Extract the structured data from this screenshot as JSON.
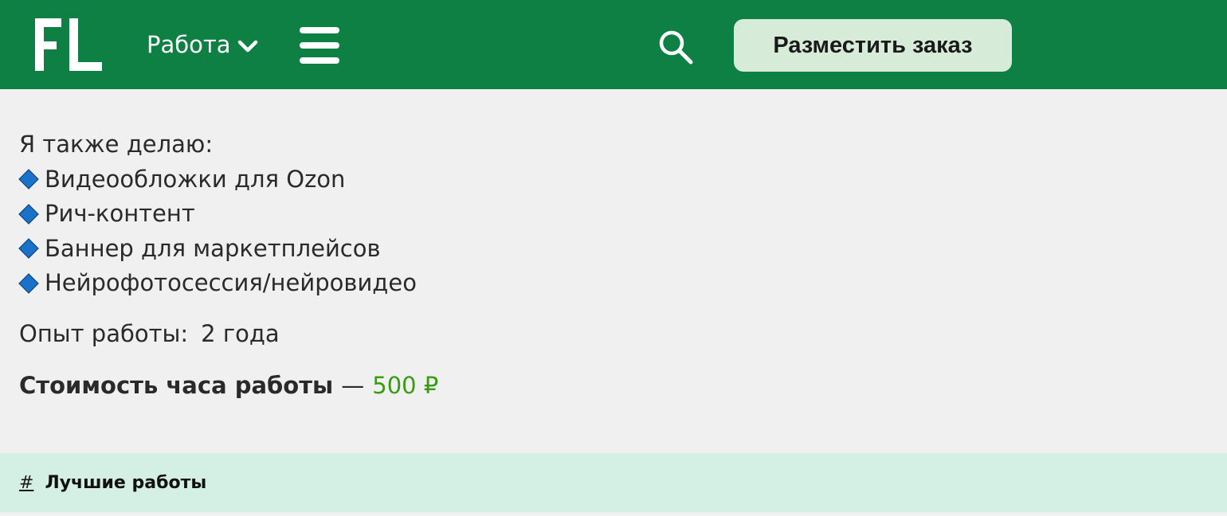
{
  "header": {
    "logo_text": "FL",
    "nav_work_label": "Работа",
    "cta_label": "Разместить заказ",
    "colors": {
      "header_bg": "#0e8043",
      "cta_bg": "#d6ecd9"
    },
    "icons": {
      "nav_chevron": "chevron-down-icon",
      "menu": "hamburger-menu-icon",
      "search": "search-icon"
    }
  },
  "content": {
    "also_do_heading": "Я также делаю:",
    "services": [
      "Видеообложки для Ozon",
      "Рич-контент",
      "Баннер для маркетплейсов",
      "Нейрофотосессия/нейровидео"
    ],
    "service_bullet_icon": "blue-diamond-icon",
    "experience_label": "Опыт работы:",
    "experience_value": "2 года",
    "hourly_rate_label": "Стоимость часа работы",
    "hourly_rate_separator": "—",
    "hourly_rate_value": "500 ₽",
    "hourly_rate_color": "#3a9a14"
  },
  "best_works": {
    "anchor_symbol": "#",
    "title": "Лучшие работы",
    "background": "#d4efe4"
  }
}
